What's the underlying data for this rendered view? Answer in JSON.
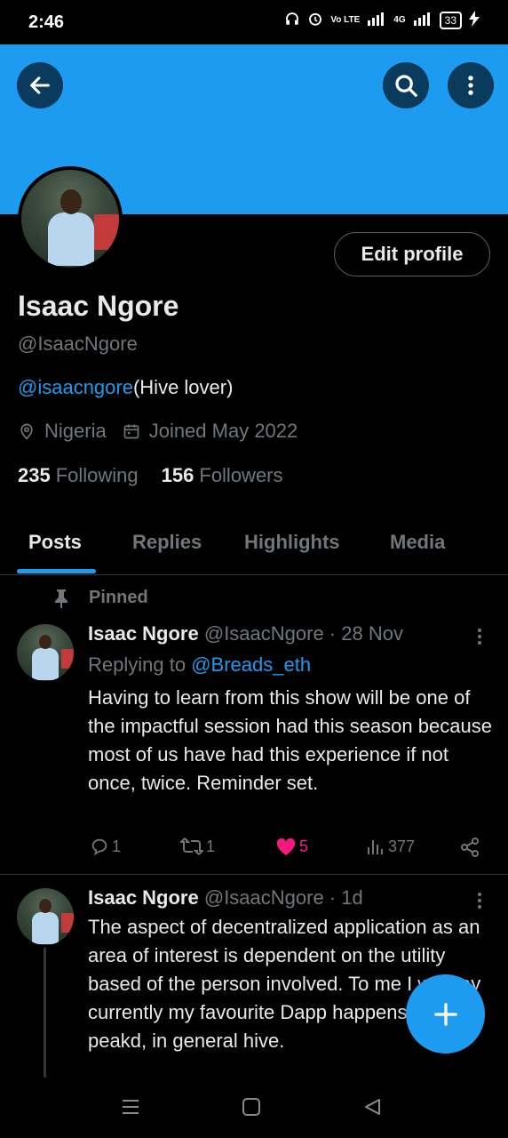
{
  "status_bar": {
    "time": "2:46",
    "network": "Vo LTE",
    "signal_label": "4G",
    "battery": "33"
  },
  "profile": {
    "display_name": "Isaac Ngore",
    "handle": "@IsaacNgore",
    "bio_mention": "@isaacngore",
    "bio_text": "(Hive lover)",
    "location": "Nigeria",
    "joined": "Joined May 2022",
    "following_count": "235",
    "following_label": "Following",
    "followers_count": "156",
    "followers_label": "Followers",
    "edit_profile_label": "Edit profile"
  },
  "tabs": [
    {
      "label": "Posts",
      "active": true
    },
    {
      "label": "Replies",
      "active": false
    },
    {
      "label": "Highlights",
      "active": false
    },
    {
      "label": "Media",
      "active": false
    }
  ],
  "posts": [
    {
      "pinned_label": "Pinned",
      "name": "Isaac Ngore",
      "meta": "@IsaacNgore · 28 Nov",
      "replying_to_label": "Replying to",
      "replying_to": "@Breads_eth",
      "text": "Having to learn from this show will be one of the impactful session had this season because most of us have had this experience if not once, twice. Reminder set.",
      "replies": "1",
      "reposts": "1",
      "likes": "5",
      "views": "377"
    },
    {
      "name": "Isaac Ngore",
      "meta": "@IsaacNgore · 1d",
      "text": "The aspect of decentralized application as an area of interest is dependent on the utility based of the person involved. To me I will say currently my favourite Dapp happens to be peakd, in general hive."
    }
  ],
  "colors": {
    "accent": "#1d9bf0",
    "like": "#f91880",
    "muted": "#71767b",
    "text": "#e7e9ea",
    "background": "#000000"
  }
}
